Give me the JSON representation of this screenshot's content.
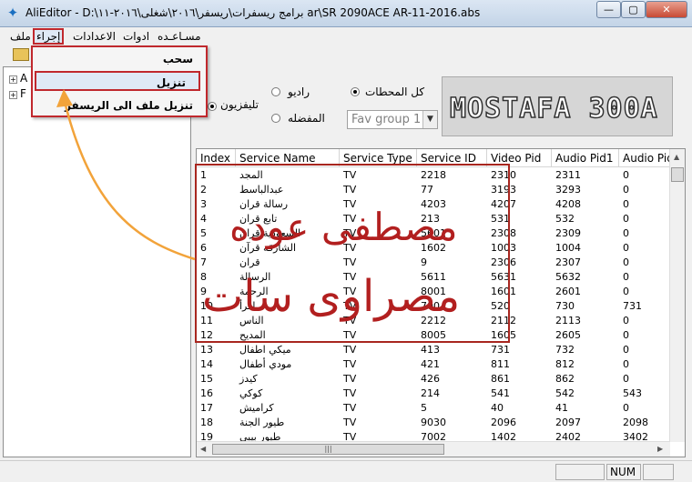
{
  "window": {
    "title": "AliEditor - D:\\برامج ريسفرات\\ريسفر\\٢٠١٦\\شغلى\\٢٠١٦-١١ ar\\SR 2090ACE AR-11-2016.abs",
    "minimize": "—",
    "maximize": "▢",
    "close": "✕"
  },
  "menubar": {
    "items": [
      "ملف",
      "إجراء",
      "الاعدادات",
      "ادوات",
      "مسـاعـده"
    ]
  },
  "dropdown": {
    "items": [
      "سحب",
      "تنزيل",
      "تنزيل ملف الى الريسفر"
    ]
  },
  "tree": {
    "nodes": [
      "A",
      "F"
    ]
  },
  "filters": {
    "tv": "تليفزيون",
    "radio": "راديو",
    "all": "كل المحطات",
    "favorite": "المفضله",
    "fav_group": "Fav group 1"
  },
  "logo": {
    "text": "MOSTAFA 300A"
  },
  "table": {
    "columns": [
      "Index",
      "Service Name",
      "Service Type",
      "Service ID",
      "Video Pid",
      "Audio Pid1",
      "Audio Pid"
    ],
    "rows": [
      [
        "1",
        "المجد",
        "TV",
        "2218",
        "2310",
        "2311",
        "0"
      ],
      [
        "2",
        "عبدالباسط",
        "TV",
        "77",
        "3193",
        "3293",
        "0"
      ],
      [
        "3",
        "رسالة قران",
        "TV",
        "4203",
        "4207",
        "4208",
        "0"
      ],
      [
        "4",
        "تابع قران",
        "TV",
        "213",
        "531",
        "532",
        "0"
      ],
      [
        "5",
        "السعودية قران",
        "TV",
        "5601",
        "2308",
        "2309",
        "0"
      ],
      [
        "6",
        "الشارقة قرآن",
        "TV",
        "1602",
        "1003",
        "1004",
        "0"
      ],
      [
        "7",
        "قران",
        "TV",
        "9",
        "2306",
        "2307",
        "0"
      ],
      [
        "8",
        "الرسالة",
        "TV",
        "5611",
        "5631",
        "5632",
        "0"
      ],
      [
        "9",
        "الرحمة",
        "TV",
        "8001",
        "1601",
        "2601",
        "0"
      ],
      [
        "10",
        "اقرأ",
        "TV",
        "700",
        "520",
        "730",
        "731"
      ],
      [
        "11",
        "الناس",
        "TV",
        "2212",
        "2112",
        "2113",
        "0"
      ],
      [
        "12",
        "المديح",
        "TV",
        "8005",
        "1605",
        "2605",
        "0"
      ],
      [
        "13",
        "ميكي اطفال",
        "TV",
        "413",
        "731",
        "732",
        "0"
      ],
      [
        "14",
        "مودي أطفال",
        "TV",
        "421",
        "811",
        "812",
        "0"
      ],
      [
        "15",
        "كيدز",
        "TV",
        "426",
        "861",
        "862",
        "0"
      ],
      [
        "16",
        "كوكي",
        "TV",
        "214",
        "541",
        "542",
        "543"
      ],
      [
        "17",
        "كراميش",
        "TV",
        "5",
        "40",
        "41",
        "0"
      ],
      [
        "18",
        "طيور الجنة",
        "TV",
        "9030",
        "2096",
        "2097",
        "2098"
      ],
      [
        "19",
        "طيور بيبي",
        "TV",
        "7002",
        "1402",
        "2402",
        "3402"
      ]
    ]
  },
  "overlay": {
    "line1": "مصطفى عوده",
    "line2": "مصراوى سات"
  },
  "statusbar": {
    "num": "NUM"
  },
  "colors": {
    "annotation_red": "#a8261f",
    "arrow_orange": "#f2a33a"
  }
}
